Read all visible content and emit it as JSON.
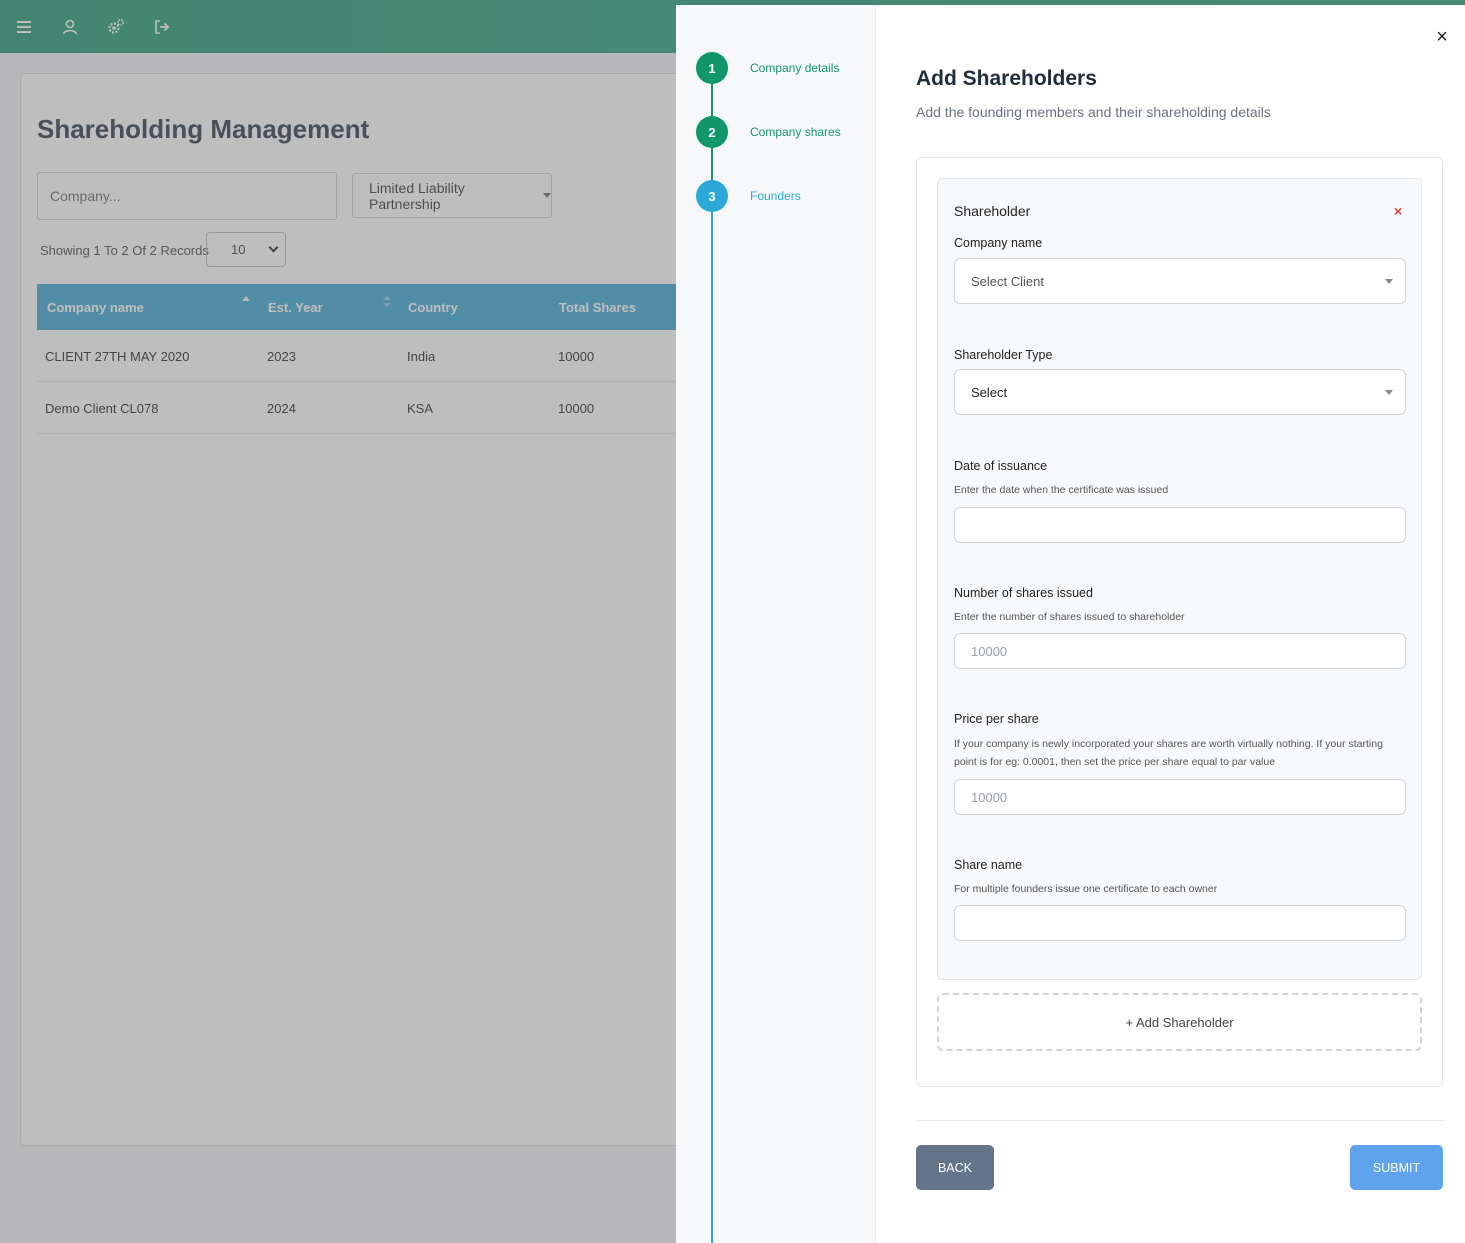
{
  "topbar": {
    "icons": [
      "menu-icon",
      "user-icon",
      "settings-icon",
      "logout-icon"
    ]
  },
  "page": {
    "title": "Shareholding Management",
    "search_placeholder": "Company...",
    "company_type": "Limited Liability Partnership",
    "records_text": "Showing 1 To 2 Of 2 Records",
    "per_page": "10"
  },
  "table": {
    "headers": [
      "Company name",
      "Est. Year",
      "Country",
      "Total Shares"
    ],
    "rows": [
      [
        "CLIENT 27TH MAY 2020",
        "2023",
        "India",
        "10000"
      ],
      [
        "Demo Client CL078",
        "2024",
        "KSA",
        "10000"
      ]
    ]
  },
  "stepper": {
    "steps": [
      {
        "number": "1",
        "label": "Company details"
      },
      {
        "number": "2",
        "label": "Company shares"
      },
      {
        "number": "3",
        "label": "Founders"
      }
    ]
  },
  "form": {
    "title": "Add Shareholders",
    "subtitle": "Add the founding members and their shareholding details",
    "shareholder": {
      "title": "Shareholder",
      "remove": "×",
      "company_name_label": "Company name",
      "company_name_value": "Select Client",
      "type_label": "Shareholder Type",
      "type_value": "Select",
      "date_label": "Date of issuance",
      "date_help": "Enter the date when the certificate was issued",
      "date_value": "",
      "shares_label": "Number of shares issued",
      "shares_help": "Enter the number of shares issued to shareholder",
      "shares_placeholder": "10000",
      "price_label": "Price per share",
      "price_help": "If your company is newly incorporated your shares are worth virtually nothing. If your starting point is for eg: 0.0001, then set the price per share equal to par value",
      "price_placeholder": "10000",
      "share_name_label": "Share name",
      "share_name_help": "For multiple founders issue one certificate to each owner",
      "share_name_value": ""
    },
    "add_shareholder": "+ Add Shareholder",
    "back": "BACK",
    "submit": "SUBMIT",
    "close": "×"
  },
  "colors": {
    "topbar": "#1e9a73",
    "table_header": "#3aa6d6",
    "step_done": "#12976b",
    "step_active": "#2aa8d8",
    "back_button": "#64748b",
    "submit_button": "#5fa3ec",
    "remove": "#e53e3e"
  }
}
